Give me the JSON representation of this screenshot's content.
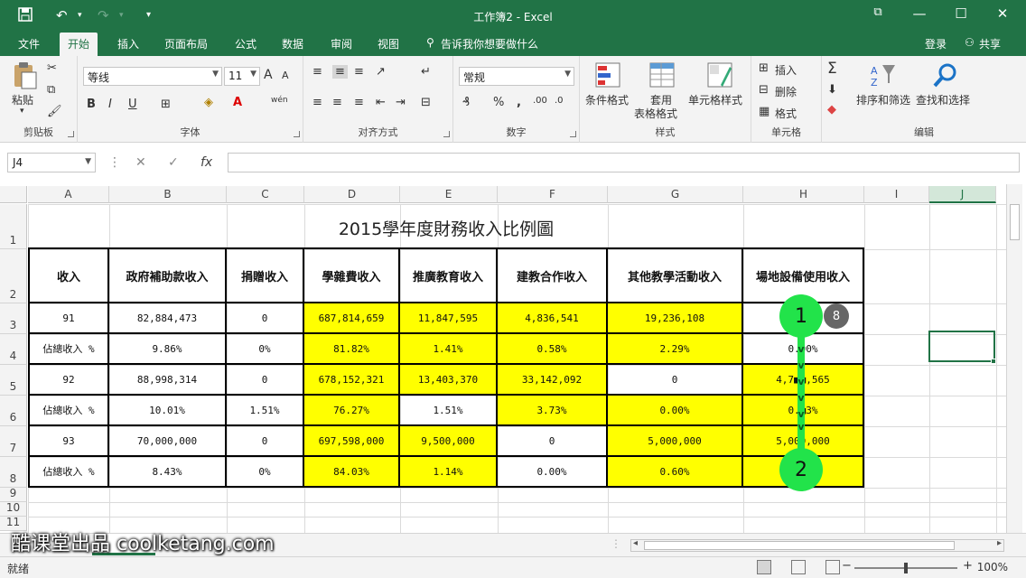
{
  "window": {
    "title": "工作簿2 - Excel",
    "minimize_glyph": "—",
    "maximize_glyph": "☐",
    "close_glyph": "✕",
    "ribbon_options_glyph": "⧉"
  },
  "tabs": [
    "文件",
    "开始",
    "插入",
    "页面布局",
    "公式",
    "数据",
    "审阅",
    "视图"
  ],
  "active_tab": "开始",
  "tell_me": "告诉我你想要做什么",
  "signin": "登录",
  "share": "共享",
  "ribbon": {
    "clipboard": {
      "label": "剪贴板",
      "paste": "粘贴"
    },
    "font": {
      "label": "字体",
      "family": "等线",
      "size": "11",
      "bold": "B",
      "italic": "I",
      "underline": "U",
      "grow": "A",
      "shrink": "A",
      "phonetic": "wén"
    },
    "alignment": {
      "label": "对齐方式"
    },
    "number": {
      "label": "数字",
      "format": "常规",
      "percent": "%",
      "comma": ","
    },
    "styles": {
      "label": "样式",
      "conditional": "条件格式",
      "table_line1": "套用",
      "table_line2": "表格格式",
      "cell_styles": "单元格样式"
    },
    "cells": {
      "label": "单元格",
      "insert": "插入",
      "delete": "删除",
      "format": "格式"
    },
    "editing": {
      "label": "编辑",
      "sum": "Σ",
      "sort": "排序和筛选",
      "find": "查找和选择"
    }
  },
  "formula_bar": {
    "name_box": "J4",
    "fx": "fx",
    "cancel": "✕",
    "enter": "✓",
    "formula": ""
  },
  "columns": [
    "A",
    "B",
    "C",
    "D",
    "E",
    "F",
    "G",
    "H",
    "I",
    "J"
  ],
  "selected_column": "J",
  "rows": [
    "1",
    "2",
    "3",
    "4",
    "5",
    "6",
    "7",
    "8",
    "9",
    "10",
    "11"
  ],
  "sheet": {
    "title": "2015學年度財務收入比例圖",
    "headers": [
      "收入",
      "政府補助款收入",
      "捐贈收入",
      "學雜費收入",
      "推廣教育收入",
      "建教合作收入",
      "其他教學活動收入",
      "場地設備使用收入"
    ],
    "data_rows": [
      [
        "91",
        "82,884,473",
        "0",
        "687,814,659",
        "11,847,595",
        "4,836,541",
        "19,236,108",
        ""
      ],
      [
        "佔總收入 %",
        "9.86%",
        "0%",
        "81.82%",
        "1.41%",
        "0.58%",
        "2.29%",
        "0.00%"
      ],
      [
        "92",
        "88,998,314",
        "0",
        "678,152,321",
        "13,403,370",
        "33,142,092",
        "0",
        "4,7■■,565"
      ],
      [
        "佔總收入 %",
        "10.01%",
        "1.51%",
        "76.27%",
        "1.51%",
        "3.73%",
        "0.00%",
        "0.■3%"
      ],
      [
        "93",
        "70,000,000",
        "0",
        "697,598,000",
        "9,500,000",
        "0",
        "5,000,000",
        "5,000,000"
      ],
      [
        "佔總收入 %",
        "8.43%",
        "0%",
        "84.03%",
        "1.14%",
        "0.00%",
        "0.60%",
        "0.■0%"
      ]
    ],
    "yellow_cells": [
      [
        0,
        3
      ],
      [
        0,
        4
      ],
      [
        0,
        5
      ],
      [
        0,
        6
      ],
      [
        1,
        3
      ],
      [
        1,
        4
      ],
      [
        1,
        5
      ],
      [
        1,
        6
      ],
      [
        2,
        3
      ],
      [
        2,
        4
      ],
      [
        2,
        5
      ],
      [
        2,
        7
      ],
      [
        3,
        3
      ],
      [
        3,
        5
      ],
      [
        3,
        6
      ],
      [
        3,
        7
      ],
      [
        4,
        3
      ],
      [
        4,
        4
      ],
      [
        4,
        6
      ],
      [
        4,
        7
      ],
      [
        5,
        3
      ],
      [
        5,
        4
      ],
      [
        5,
        6
      ],
      [
        5,
        7
      ]
    ]
  },
  "annotation": {
    "marker_start": "1",
    "marker_end": "2",
    "badge": "8",
    "chevron": "v"
  },
  "watermark": "酷课堂出品 coolketang.com",
  "status": {
    "ready": "就绪",
    "zoom": "100%"
  }
}
